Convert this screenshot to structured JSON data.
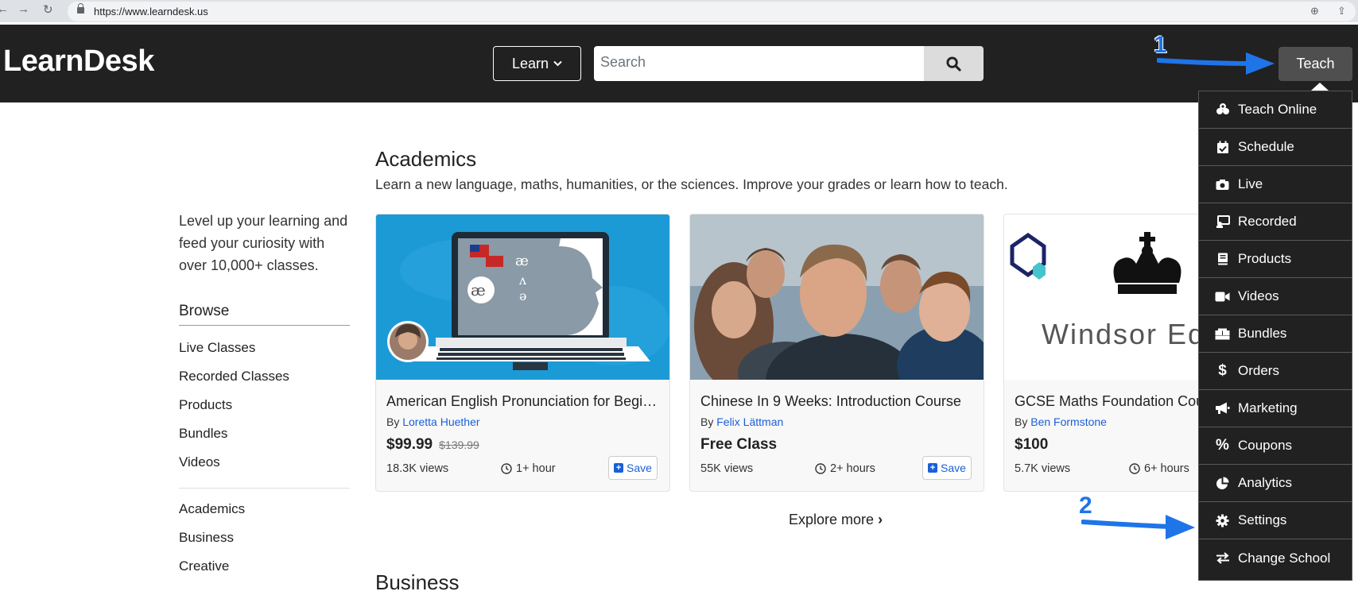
{
  "browser": {
    "url": "https://www.learndesk.us"
  },
  "header": {
    "logo": "LearnDesk",
    "learn_label": "Learn",
    "search_placeholder": "Search",
    "teach_label": "Teach"
  },
  "sidebar": {
    "tagline": "Level up your learning and feed your curiosity with over 10,000+ classes.",
    "browse_title": "Browse",
    "browse_links": [
      "Live Classes",
      "Recorded Classes",
      "Products",
      "Bundles",
      "Videos"
    ],
    "category_links": [
      "Academics",
      "Business",
      "Creative"
    ]
  },
  "section": {
    "title": "Academics",
    "subtitle": "Learn a new language, maths, humanities, or the sciences. Improve your grades or learn how to teach.",
    "explore_label": "Explore more",
    "next_title": "Business"
  },
  "cards": [
    {
      "title": "American English Pronunciation for Beginners",
      "by_prefix": "By",
      "author": "Loretta Huether",
      "price": "$99.99",
      "old_price": "$139.99",
      "views": "18.3K views",
      "duration": "1+ hour",
      "save_label": "Save"
    },
    {
      "title": "Chinese In 9 Weeks: Introduction Course",
      "by_prefix": "By",
      "author": "Felix Lättman",
      "price": "Free Class",
      "views": "55K views",
      "duration": "2+ hours",
      "save_label": "Save"
    },
    {
      "title": "GCSE Maths Foundation Course",
      "by_prefix": "By",
      "author": "Ben Formstone",
      "price": "$100",
      "views": "5.7K views",
      "duration": "6+ hours",
      "image_text": "Windsor Educ"
    }
  ],
  "teach_menu": {
    "items": [
      {
        "label": "Teach Online",
        "icon": "teach-online-icon"
      },
      {
        "label": "Schedule",
        "icon": "calendar-check-icon"
      },
      {
        "label": "Live",
        "icon": "camera-icon"
      },
      {
        "label": "Recorded",
        "icon": "recorded-icon"
      },
      {
        "label": "Products",
        "icon": "book-icon"
      },
      {
        "label": "Videos",
        "icon": "video-icon"
      },
      {
        "label": "Bundles",
        "icon": "boxes-icon"
      },
      {
        "label": "Orders",
        "icon": "dollar-icon"
      },
      {
        "label": "Marketing",
        "icon": "megaphone-icon"
      },
      {
        "label": "Coupons",
        "icon": "percent-icon"
      },
      {
        "label": "Analytics",
        "icon": "pie-chart-icon"
      },
      {
        "label": "Settings",
        "icon": "gear-icon"
      },
      {
        "label": "Change School",
        "icon": "exchange-icon"
      }
    ]
  },
  "annotations": {
    "step1": "1",
    "step2": "2",
    "color": "#1f74e8"
  }
}
